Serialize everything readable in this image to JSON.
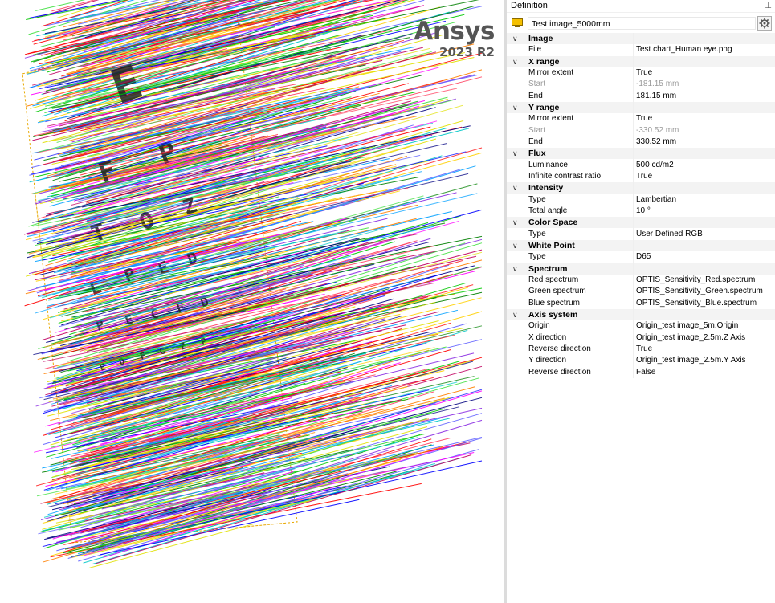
{
  "brand": {
    "name": "Ansys",
    "version": "2023 R2"
  },
  "panel": {
    "title": "Definition",
    "pin_icon": "pin-icon",
    "object_name": "Test image_5000mm",
    "object_icon": "display-source-icon",
    "settings_icon": "gear-icon"
  },
  "viewport_text": {
    "chart_letters": [
      "E",
      "F",
      "P",
      "T",
      "O",
      "Z",
      "L",
      "P",
      "E",
      "D",
      "P",
      "E",
      "C",
      "F",
      "D",
      "E",
      "D",
      "F",
      "C",
      "Z",
      "P"
    ]
  },
  "categories": [
    {
      "label": "Image",
      "rows": [
        {
          "name": "File",
          "value": "Test chart_Human eye.png",
          "disabled": false
        }
      ]
    },
    {
      "label": "X range",
      "rows": [
        {
          "name": "Mirror extent",
          "value": "True",
          "disabled": false
        },
        {
          "name": "Start",
          "value": "-181.15 mm",
          "disabled": true
        },
        {
          "name": "End",
          "value": "181.15 mm",
          "disabled": false
        }
      ]
    },
    {
      "label": "Y range",
      "rows": [
        {
          "name": "Mirror extent",
          "value": "True",
          "disabled": false
        },
        {
          "name": "Start",
          "value": "-330.52 mm",
          "disabled": true
        },
        {
          "name": "End",
          "value": "330.52 mm",
          "disabled": false
        }
      ]
    },
    {
      "label": "Flux",
      "rows": [
        {
          "name": "Luminance",
          "value": "500 cd/m2",
          "disabled": false
        },
        {
          "name": "Infinite contrast ratio",
          "value": "True",
          "disabled": false
        }
      ]
    },
    {
      "label": "Intensity",
      "rows": [
        {
          "name": "Type",
          "value": "Lambertian",
          "disabled": false
        },
        {
          "name": "Total angle",
          "value": "10 °",
          "disabled": false
        }
      ]
    },
    {
      "label": "Color Space",
      "rows": [
        {
          "name": "Type",
          "value": "User Defined RGB",
          "disabled": false
        }
      ]
    },
    {
      "label": "White Point",
      "rows": [
        {
          "name": "Type",
          "value": "D65",
          "disabled": false
        }
      ]
    },
    {
      "label": "Spectrum",
      "rows": [
        {
          "name": "Red spectrum",
          "value": "OPTIS_Sensitivity_Red.spectrum",
          "disabled": false
        },
        {
          "name": "Green spectrum",
          "value": "OPTIS_Sensitivity_Green.spectrum",
          "disabled": false
        },
        {
          "name": "Blue spectrum",
          "value": "OPTIS_Sensitivity_Blue.spectrum",
          "disabled": false
        }
      ]
    },
    {
      "label": "Axis system",
      "rows": [
        {
          "name": "Origin",
          "value": "Origin_test image_5m.Origin",
          "disabled": false
        },
        {
          "name": "X direction",
          "value": "Origin_test image_2.5m.Z Axis",
          "disabled": false
        },
        {
          "name": "Reverse direction",
          "value": "True",
          "disabled": false
        },
        {
          "name": "Y direction",
          "value": "Origin_test image_2.5m.Y Axis",
          "disabled": false
        },
        {
          "name": "Reverse direction",
          "value": "False",
          "disabled": false
        }
      ]
    }
  ],
  "colors": {
    "ray_palette": [
      "#ff0000",
      "#00c800",
      "#0000ff",
      "#ff00ff",
      "#ffd000",
      "#00c8c8",
      "#8a2be2",
      "#ff8000",
      "#008000",
      "#000080",
      "#c00060",
      "#40e040",
      "#6060ff",
      "#e0e000",
      "#ff4060",
      "#00a0ff"
    ],
    "frame": "#e8a800",
    "brand": "#555555"
  }
}
